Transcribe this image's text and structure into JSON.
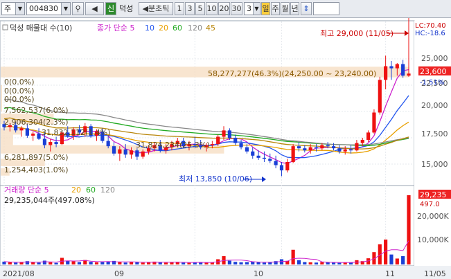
{
  "toolbar": {
    "market": "주",
    "code": "004830",
    "sin_label": "신",
    "stock_name": "덕성",
    "period_label": "◀분초틱",
    "intervals": [
      "1",
      "3",
      "5",
      "10",
      "20",
      "30"
    ],
    "count_value": "3",
    "day_label": "일",
    "week_label": "주",
    "month_label": "월",
    "year_label": "년"
  },
  "legend": {
    "main": "덕성 매물대 수(10)",
    "ma_title": "종가 단순 5",
    "ma_periods": [
      "10",
      "20",
      "60",
      "120",
      "45"
    ],
    "ma_colors": [
      "#cc22cc",
      "#2255ee",
      "#e8a000",
      "#22aa22",
      "#888888",
      "#b8860b"
    ],
    "volume_title": "거래량 단순 5",
    "volume_periods": [
      "20",
      "60",
      "120"
    ]
  },
  "annotations": {
    "high": "최고 29,000 (11/05)",
    "low": "최저 13,850 (10/06)",
    "top_bar": "58,277,277(46.3%)(24,250.00 ~ 23,240.00)",
    "volume_value": "29,235,044주(497.08%)",
    "lc_label": "LC:70.40",
    "hc_label": "HC:-18.6",
    "current_price": "23,600",
    "current_change": "-1.51%",
    "volume_tag": "29,235",
    "volume_pct": "497.0"
  },
  "profile_labels": [
    "0(0.0%)",
    "0(0.0%)",
    "0(0.0%)",
    "7,562,537(6.0%)",
    "2,906,304(2.3%)",
    "31,832,112(1.4%)",
    "31,824,234(25.3%)",
    "6,281,897(5.0%)",
    "1,254,403(1.0%)"
  ],
  "chart_data": {
    "type": "candlestick",
    "price_axis": [
      "25,000",
      "22,500",
      "20,000",
      "17,500",
      "15,000"
    ],
    "volume_axis": [
      "20,000K",
      "10,000K"
    ],
    "x_labels": [
      "2021/08",
      "09",
      "10",
      "11",
      "11/05"
    ],
    "candles": [
      {
        "o": 18800,
        "h": 19100,
        "l": 18200,
        "c": 18500
      },
      {
        "o": 18500,
        "h": 18900,
        "l": 18100,
        "c": 18700
      },
      {
        "o": 18700,
        "h": 19000,
        "l": 18000,
        "c": 18200
      },
      {
        "o": 18200,
        "h": 18600,
        "l": 17600,
        "c": 18400
      },
      {
        "o": 18400,
        "h": 18800,
        "l": 17500,
        "c": 17700
      },
      {
        "o": 17700,
        "h": 18100,
        "l": 17200,
        "c": 17900
      },
      {
        "o": 17900,
        "h": 18400,
        "l": 17300,
        "c": 17400
      },
      {
        "o": 17400,
        "h": 18000,
        "l": 16500,
        "c": 16800
      },
      {
        "o": 16800,
        "h": 17400,
        "l": 16200,
        "c": 17100
      },
      {
        "o": 17100,
        "h": 17600,
        "l": 16600,
        "c": 16900
      },
      {
        "o": 16900,
        "h": 18200,
        "l": 16800,
        "c": 18000
      },
      {
        "o": 18000,
        "h": 18600,
        "l": 17500,
        "c": 17700
      },
      {
        "o": 17700,
        "h": 18500,
        "l": 17300,
        "c": 18300
      },
      {
        "o": 18300,
        "h": 18700,
        "l": 17800,
        "c": 18000
      },
      {
        "o": 18000,
        "h": 18900,
        "l": 17600,
        "c": 18600
      },
      {
        "o": 18600,
        "h": 18800,
        "l": 17500,
        "c": 17700
      },
      {
        "o": 17700,
        "h": 18300,
        "l": 17200,
        "c": 18100
      },
      {
        "o": 18100,
        "h": 18400,
        "l": 17000,
        "c": 17200
      },
      {
        "o": 17200,
        "h": 17600,
        "l": 16500,
        "c": 16700
      },
      {
        "o": 16700,
        "h": 17100,
        "l": 15800,
        "c": 16000
      },
      {
        "o": 16000,
        "h": 16700,
        "l": 15300,
        "c": 16400
      },
      {
        "o": 16400,
        "h": 16900,
        "l": 15600,
        "c": 15900
      },
      {
        "o": 15900,
        "h": 16600,
        "l": 15500,
        "c": 16300
      },
      {
        "o": 16300,
        "h": 16500,
        "l": 15400,
        "c": 15700
      },
      {
        "o": 15700,
        "h": 16400,
        "l": 15500,
        "c": 16200
      },
      {
        "o": 16200,
        "h": 16800,
        "l": 15900,
        "c": 16500
      },
      {
        "o": 16500,
        "h": 17100,
        "l": 16200,
        "c": 16800
      },
      {
        "o": 16800,
        "h": 17300,
        "l": 16100,
        "c": 16300
      },
      {
        "o": 16300,
        "h": 16900,
        "l": 16000,
        "c": 16600
      },
      {
        "o": 16600,
        "h": 17200,
        "l": 16300,
        "c": 16900
      },
      {
        "o": 16900,
        "h": 17500,
        "l": 16600,
        "c": 17200
      },
      {
        "o": 17200,
        "h": 17500,
        "l": 16500,
        "c": 16700
      },
      {
        "o": 16700,
        "h": 17200,
        "l": 16300,
        "c": 16900
      },
      {
        "o": 16900,
        "h": 17600,
        "l": 16500,
        "c": 16800
      },
      {
        "o": 16800,
        "h": 17300,
        "l": 16400,
        "c": 16600
      },
      {
        "o": 16600,
        "h": 17000,
        "l": 16200,
        "c": 16800
      },
      {
        "o": 16800,
        "h": 17200,
        "l": 16500,
        "c": 16900
      },
      {
        "o": 16900,
        "h": 17800,
        "l": 16700,
        "c": 17600
      },
      {
        "o": 17600,
        "h": 18600,
        "l": 17300,
        "c": 18200
      },
      {
        "o": 18200,
        "h": 18400,
        "l": 17300,
        "c": 17500
      },
      {
        "o": 17500,
        "h": 17800,
        "l": 16800,
        "c": 17000
      },
      {
        "o": 17000,
        "h": 17300,
        "l": 16400,
        "c": 16600
      },
      {
        "o": 16600,
        "h": 16900,
        "l": 16000,
        "c": 16200
      },
      {
        "o": 16200,
        "h": 16600,
        "l": 15500,
        "c": 15800
      },
      {
        "o": 15800,
        "h": 16300,
        "l": 15400,
        "c": 15600
      },
      {
        "o": 15600,
        "h": 16200,
        "l": 15200,
        "c": 15500
      },
      {
        "o": 15500,
        "h": 16000,
        "l": 15100,
        "c": 15300
      },
      {
        "o": 15300,
        "h": 15800,
        "l": 14600,
        "c": 14900
      },
      {
        "o": 14900,
        "h": 15200,
        "l": 13850,
        "c": 14400
      },
      {
        "o": 14400,
        "h": 15500,
        "l": 14200,
        "c": 15200
      },
      {
        "o": 15200,
        "h": 16900,
        "l": 15100,
        "c": 16700
      },
      {
        "o": 16700,
        "h": 17100,
        "l": 16200,
        "c": 16500
      },
      {
        "o": 16500,
        "h": 16800,
        "l": 16100,
        "c": 16300
      },
      {
        "o": 16300,
        "h": 16900,
        "l": 16000,
        "c": 16600
      },
      {
        "o": 16600,
        "h": 16900,
        "l": 16200,
        "c": 16500
      },
      {
        "o": 16500,
        "h": 17000,
        "l": 16300,
        "c": 16800
      },
      {
        "o": 16800,
        "h": 17100,
        "l": 16500,
        "c": 16700
      },
      {
        "o": 16700,
        "h": 17000,
        "l": 16300,
        "c": 16500
      },
      {
        "o": 16500,
        "h": 16800,
        "l": 16000,
        "c": 16200
      },
      {
        "o": 16200,
        "h": 16700,
        "l": 15900,
        "c": 16400
      },
      {
        "o": 16400,
        "h": 16800,
        "l": 16000,
        "c": 16300
      },
      {
        "o": 16300,
        "h": 17300,
        "l": 16200,
        "c": 17000
      },
      {
        "o": 17000,
        "h": 17500,
        "l": 16700,
        "c": 17300
      },
      {
        "o": 17300,
        "h": 18200,
        "l": 17100,
        "c": 18000
      },
      {
        "o": 18000,
        "h": 20200,
        "l": 17900,
        "c": 19900
      },
      {
        "o": 19900,
        "h": 23300,
        "l": 19700,
        "c": 23000
      },
      {
        "o": 23000,
        "h": 25300,
        "l": 22100,
        "c": 24300
      },
      {
        "o": 24300,
        "h": 24800,
        "l": 23000,
        "c": 24100
      },
      {
        "o": 24100,
        "h": 24600,
        "l": 23400,
        "c": 24500
      },
      {
        "o": 24500,
        "h": 24900,
        "l": 23200,
        "c": 23400
      },
      {
        "o": 23400,
        "h": 29000,
        "l": 23300,
        "c": 23600
      }
    ],
    "volume": [
      1.2,
      0.9,
      0.8,
      1.0,
      1.4,
      0.9,
      0.8,
      1.6,
      0.9,
      0.7,
      2.8,
      1.6,
      1.3,
      1.0,
      1.9,
      1.1,
      0.9,
      1.0,
      1.2,
      1.5,
      1.0,
      0.8,
      1.1,
      0.9,
      0.8,
      1.0,
      1.2,
      0.9,
      0.8,
      0.9,
      1.1,
      0.8,
      0.7,
      0.9,
      1.0,
      0.8,
      0.9,
      2.2,
      3.5,
      1.6,
      1.1,
      0.9,
      1.0,
      1.2,
      0.9,
      0.8,
      0.9,
      1.4,
      2.2,
      1.5,
      6.2,
      1.8,
      1.0,
      0.9,
      0.8,
      1.0,
      0.9,
      0.8,
      0.7,
      0.8,
      0.9,
      1.8,
      1.4,
      2.6,
      5.2,
      8.5,
      10.5,
      4.2,
      2.5,
      3.5,
      29.2
    ],
    "profile": [
      0,
      0,
      0,
      6.0,
      2.3,
      1.4,
      25.3,
      5.0,
      1.0,
      46.3
    ]
  }
}
